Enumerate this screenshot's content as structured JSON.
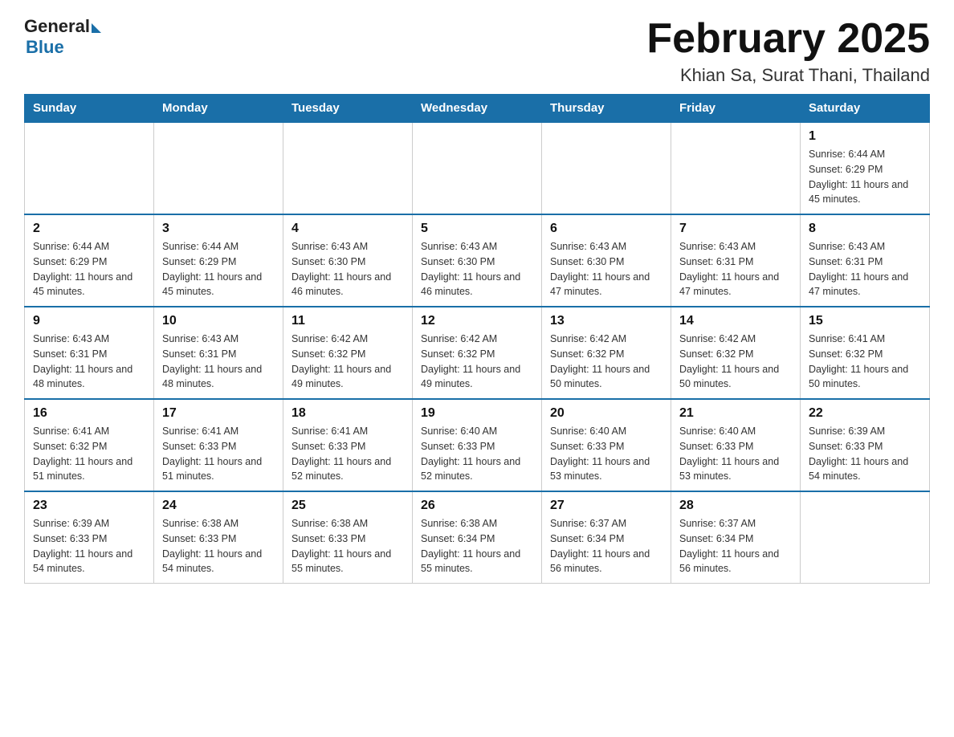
{
  "header": {
    "logo_general": "General",
    "logo_blue": "Blue",
    "title": "February 2025",
    "location": "Khian Sa, Surat Thani, Thailand"
  },
  "weekdays": [
    "Sunday",
    "Monday",
    "Tuesday",
    "Wednesday",
    "Thursday",
    "Friday",
    "Saturday"
  ],
  "weeks": [
    [
      {
        "day": "",
        "info": ""
      },
      {
        "day": "",
        "info": ""
      },
      {
        "day": "",
        "info": ""
      },
      {
        "day": "",
        "info": ""
      },
      {
        "day": "",
        "info": ""
      },
      {
        "day": "",
        "info": ""
      },
      {
        "day": "1",
        "info": "Sunrise: 6:44 AM\nSunset: 6:29 PM\nDaylight: 11 hours and 45 minutes."
      }
    ],
    [
      {
        "day": "2",
        "info": "Sunrise: 6:44 AM\nSunset: 6:29 PM\nDaylight: 11 hours and 45 minutes."
      },
      {
        "day": "3",
        "info": "Sunrise: 6:44 AM\nSunset: 6:29 PM\nDaylight: 11 hours and 45 minutes."
      },
      {
        "day": "4",
        "info": "Sunrise: 6:43 AM\nSunset: 6:30 PM\nDaylight: 11 hours and 46 minutes."
      },
      {
        "day": "5",
        "info": "Sunrise: 6:43 AM\nSunset: 6:30 PM\nDaylight: 11 hours and 46 minutes."
      },
      {
        "day": "6",
        "info": "Sunrise: 6:43 AM\nSunset: 6:30 PM\nDaylight: 11 hours and 47 minutes."
      },
      {
        "day": "7",
        "info": "Sunrise: 6:43 AM\nSunset: 6:31 PM\nDaylight: 11 hours and 47 minutes."
      },
      {
        "day": "8",
        "info": "Sunrise: 6:43 AM\nSunset: 6:31 PM\nDaylight: 11 hours and 47 minutes."
      }
    ],
    [
      {
        "day": "9",
        "info": "Sunrise: 6:43 AM\nSunset: 6:31 PM\nDaylight: 11 hours and 48 minutes."
      },
      {
        "day": "10",
        "info": "Sunrise: 6:43 AM\nSunset: 6:31 PM\nDaylight: 11 hours and 48 minutes."
      },
      {
        "day": "11",
        "info": "Sunrise: 6:42 AM\nSunset: 6:32 PM\nDaylight: 11 hours and 49 minutes."
      },
      {
        "day": "12",
        "info": "Sunrise: 6:42 AM\nSunset: 6:32 PM\nDaylight: 11 hours and 49 minutes."
      },
      {
        "day": "13",
        "info": "Sunrise: 6:42 AM\nSunset: 6:32 PM\nDaylight: 11 hours and 50 minutes."
      },
      {
        "day": "14",
        "info": "Sunrise: 6:42 AM\nSunset: 6:32 PM\nDaylight: 11 hours and 50 minutes."
      },
      {
        "day": "15",
        "info": "Sunrise: 6:41 AM\nSunset: 6:32 PM\nDaylight: 11 hours and 50 minutes."
      }
    ],
    [
      {
        "day": "16",
        "info": "Sunrise: 6:41 AM\nSunset: 6:32 PM\nDaylight: 11 hours and 51 minutes."
      },
      {
        "day": "17",
        "info": "Sunrise: 6:41 AM\nSunset: 6:33 PM\nDaylight: 11 hours and 51 minutes."
      },
      {
        "day": "18",
        "info": "Sunrise: 6:41 AM\nSunset: 6:33 PM\nDaylight: 11 hours and 52 minutes."
      },
      {
        "day": "19",
        "info": "Sunrise: 6:40 AM\nSunset: 6:33 PM\nDaylight: 11 hours and 52 minutes."
      },
      {
        "day": "20",
        "info": "Sunrise: 6:40 AM\nSunset: 6:33 PM\nDaylight: 11 hours and 53 minutes."
      },
      {
        "day": "21",
        "info": "Sunrise: 6:40 AM\nSunset: 6:33 PM\nDaylight: 11 hours and 53 minutes."
      },
      {
        "day": "22",
        "info": "Sunrise: 6:39 AM\nSunset: 6:33 PM\nDaylight: 11 hours and 54 minutes."
      }
    ],
    [
      {
        "day": "23",
        "info": "Sunrise: 6:39 AM\nSunset: 6:33 PM\nDaylight: 11 hours and 54 minutes."
      },
      {
        "day": "24",
        "info": "Sunrise: 6:38 AM\nSunset: 6:33 PM\nDaylight: 11 hours and 54 minutes."
      },
      {
        "day": "25",
        "info": "Sunrise: 6:38 AM\nSunset: 6:33 PM\nDaylight: 11 hours and 55 minutes."
      },
      {
        "day": "26",
        "info": "Sunrise: 6:38 AM\nSunset: 6:34 PM\nDaylight: 11 hours and 55 minutes."
      },
      {
        "day": "27",
        "info": "Sunrise: 6:37 AM\nSunset: 6:34 PM\nDaylight: 11 hours and 56 minutes."
      },
      {
        "day": "28",
        "info": "Sunrise: 6:37 AM\nSunset: 6:34 PM\nDaylight: 11 hours and 56 minutes."
      },
      {
        "day": "",
        "info": ""
      }
    ]
  ]
}
